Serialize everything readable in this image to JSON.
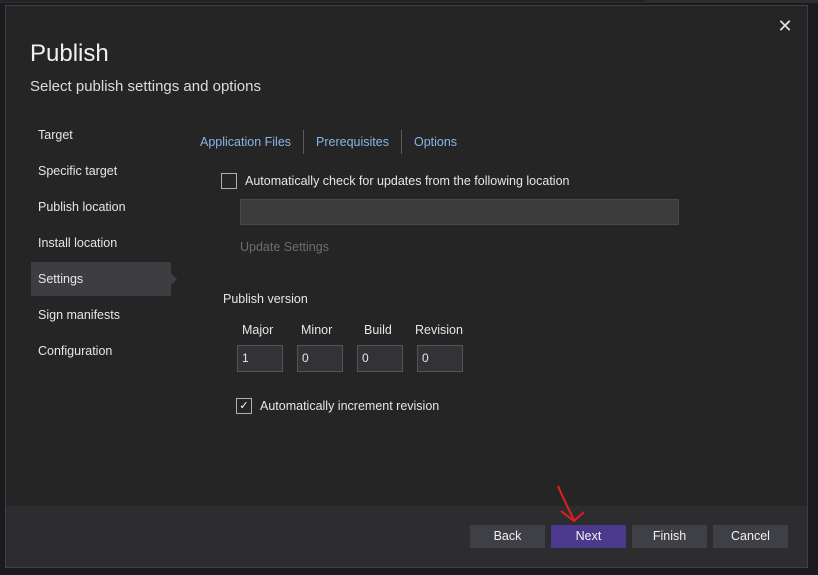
{
  "dialog": {
    "title": "Publish",
    "subtitle": "Select publish settings and options",
    "close_icon": "close-icon",
    "close_glyph": "✕"
  },
  "sidebar": {
    "items": [
      {
        "label": "Target",
        "active": false
      },
      {
        "label": "Specific target",
        "active": false
      },
      {
        "label": "Publish location",
        "active": false
      },
      {
        "label": "Install location",
        "active": false
      },
      {
        "label": "Settings",
        "active": true
      },
      {
        "label": "Sign manifests",
        "active": false
      },
      {
        "label": "Configuration",
        "active": false
      }
    ]
  },
  "tabs": [
    "Application Files",
    "Prerequisites",
    "Options"
  ],
  "updates": {
    "check_label": "Automatically check for updates from the following location",
    "checked": false,
    "location_value": "",
    "settings_link": "Update Settings"
  },
  "publish_version": {
    "label": "Publish version",
    "fields": [
      {
        "label": "Major",
        "value": "1"
      },
      {
        "label": "Minor",
        "value": "0"
      },
      {
        "label": "Build",
        "value": "0"
      },
      {
        "label": "Revision",
        "value": "0"
      }
    ],
    "auto_increment_label": "Automatically increment revision",
    "auto_increment_checked": true,
    "check_glyph": "✓"
  },
  "footer": {
    "back": "Back",
    "next": "Next",
    "finish": "Finish",
    "cancel": "Cancel"
  },
  "colors": {
    "accent": "#4b3a8c",
    "link": "#8ab4e8",
    "annotation_arrow": "#e0201c"
  }
}
